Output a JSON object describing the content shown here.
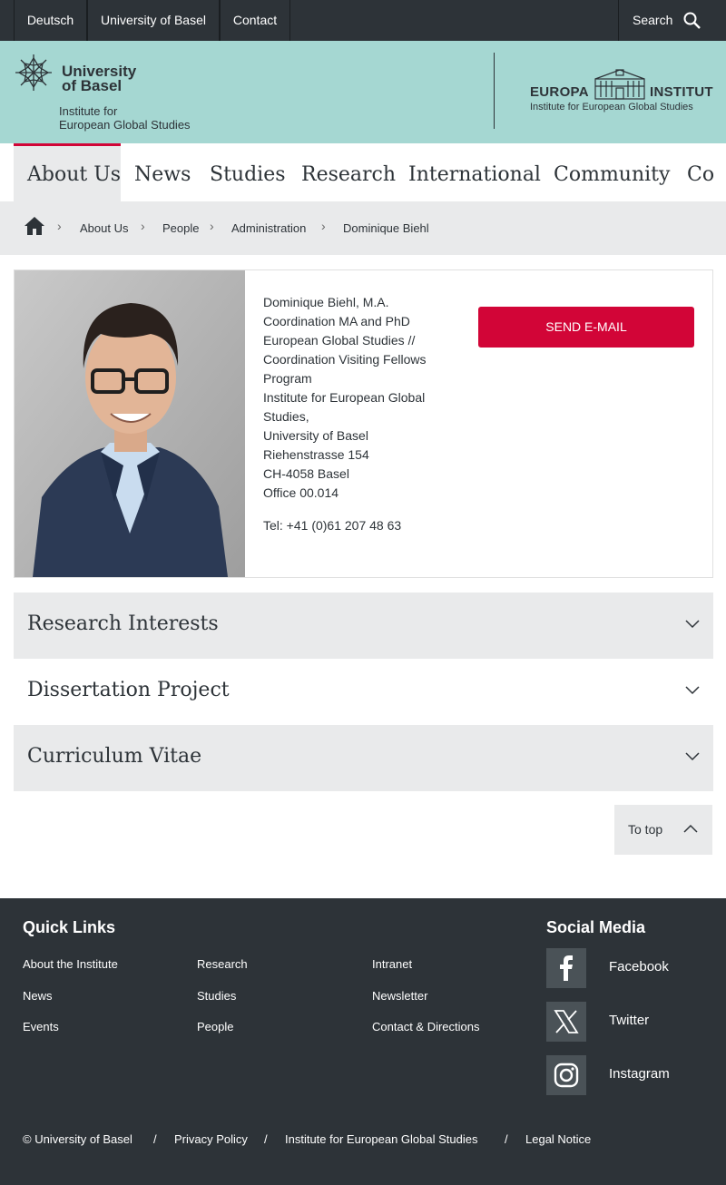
{
  "topbar": {
    "links": [
      "Deutsch",
      "University of Basel",
      "Contact"
    ],
    "search_label": "Search"
  },
  "header": {
    "university_line1": "University",
    "university_line2": "of Basel",
    "institute_line1": "Institute for",
    "institute_line2": "European Global Studies",
    "europa_left": "EUROPA",
    "europa_right": "INSTITUT",
    "europa_sub": "Institute for European Global Studies"
  },
  "nav": {
    "items": [
      "About Us",
      "News",
      "Studies",
      "Research",
      "International",
      "Community",
      "Co"
    ],
    "active_index": 0
  },
  "breadcrumb": {
    "items": [
      "About Us",
      "People",
      "Administration",
      "Dominique Biehl"
    ]
  },
  "person": {
    "name": "Dominique Biehl, M.A.",
    "role_lines": [
      "Coordination MA and PhD",
      "European Global Studies //",
      "Coordination Visiting Fellows",
      "Program"
    ],
    "address_lines": [
      "Institute for European Global",
      "Studies,",
      "University of Basel",
      "Riehenstrasse 154",
      "CH-4058 Basel",
      "Office 00.014"
    ],
    "tel": "Tel: +41 (0)61 207 48 63",
    "send_email_label": "SEND E-MAIL"
  },
  "accordions": [
    {
      "title": "Research Interests"
    },
    {
      "title": "Dissertation Project"
    },
    {
      "title": "Curriculum Vitae"
    }
  ],
  "to_top_label": "To top",
  "footer": {
    "quick_links_title": "Quick Links",
    "quick_links": [
      [
        "About the Institute",
        "Research",
        "Intranet"
      ],
      [
        "News",
        "Studies",
        "Newsletter"
      ],
      [
        "Events",
        "People",
        "Contact & Directions"
      ]
    ],
    "social_title": "Social Media",
    "social": [
      "Facebook",
      "Twitter",
      "Instagram"
    ],
    "bottom_links": [
      "© University of Basel",
      "Privacy Policy",
      "Institute for European Global Studies",
      "Legal Notice"
    ],
    "separator": "/"
  },
  "colors": {
    "dark": "#2d3338",
    "mint": "#a5d7d2",
    "accent_red": "#d20537",
    "light_grey": "#e9eaeb"
  }
}
